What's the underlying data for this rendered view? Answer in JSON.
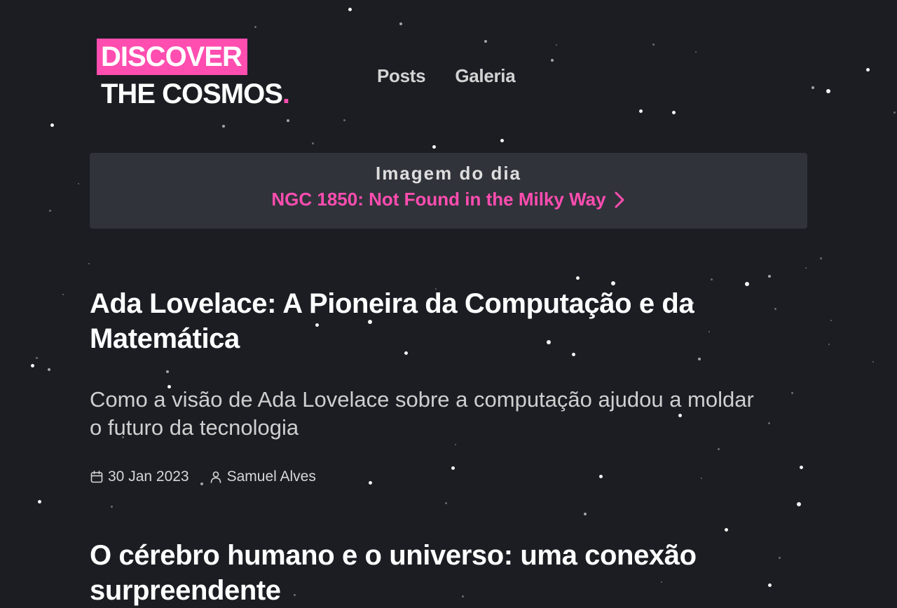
{
  "logo": {
    "line1": "DISCOVER",
    "line2": "THE COSMOS",
    "dot": "."
  },
  "nav": {
    "posts": "Posts",
    "gallery": "Galeria"
  },
  "apod": {
    "heading": "Imagem do dia",
    "link": "NGC 1850: Not Found in the Milky Way",
    "link_icon": "chevron-right-icon"
  },
  "posts": [
    {
      "title": "Ada Lovelace: A Pioneira da Computação e da Matemática",
      "subtitle": "Como a visão de Ada Lovelace sobre a computação ajudou a moldar o futuro da tecnologia",
      "date": "30 Jan 2023",
      "author": "Samuel Alves"
    },
    {
      "title": "O cérebro humano e o universo: uma conexão surpreendente"
    }
  ],
  "colors": {
    "background": "#1b1d23",
    "accent": "#ff4db0",
    "panel": "#30333a"
  }
}
